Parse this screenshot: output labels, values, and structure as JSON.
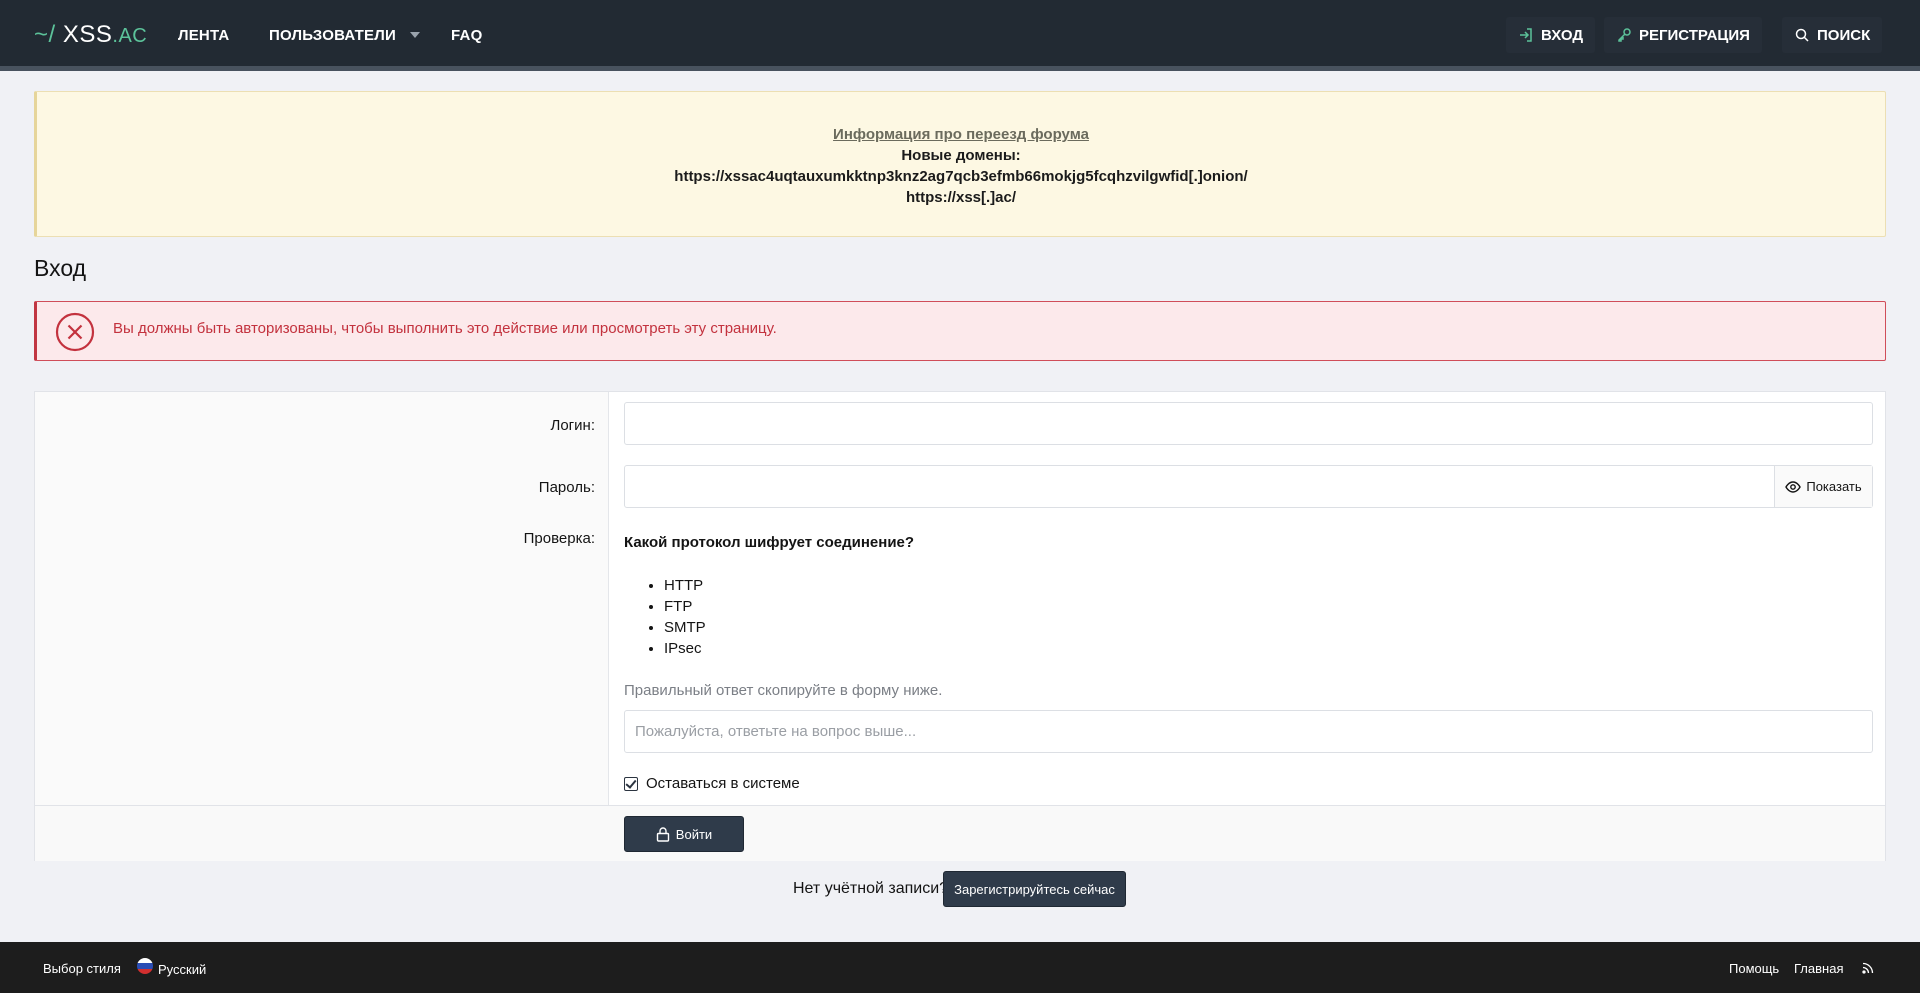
{
  "header": {
    "logo": {
      "tilde": "~/",
      "name": "XSS",
      "tld": ".AC"
    },
    "nav": [
      {
        "label": "ЛЕНТА"
      },
      {
        "label": "ПОЛЬЗОВАТЕЛИ"
      },
      {
        "label": "FAQ"
      }
    ],
    "actions": {
      "login": "ВХОД",
      "register": "РЕГИСТРАЦИЯ",
      "search": "ПОИСК"
    }
  },
  "notice": {
    "link": "Информация про переезд форума",
    "line1": "Новые домены:",
    "line2": "https://xssac4uqtauxumkktnp3knz2ag7qcb3efmb66mokjg5fcqhzvilgwfid[.]onion/",
    "line3": "https://xss[.]ac/"
  },
  "page_title": "Вход",
  "error_message": "Вы должны быть авторизованы, чтобы выполнить это действие или просмотреть эту страницу.",
  "form": {
    "login_label": "Логин:",
    "password_label": "Пароль:",
    "show_label": "Показать",
    "captcha_label": "Проверка:",
    "question": "Какой протокол шифрует соединение?",
    "options": [
      "HTTP",
      "FTP",
      "SMTP",
      "IPsec"
    ],
    "hint": "Правильный ответ скопируйте в форму ниже.",
    "answer_placeholder": "Пожалуйста, ответьте на вопрос выше...",
    "remember_label": "Оставаться в системе",
    "submit_label": "Войти"
  },
  "signup": {
    "prompt": "Нет учётной записи?",
    "button": "Зарегистрируйтесь сейчас"
  },
  "footer": {
    "style_chooser": "Выбор стиля",
    "language": "Русский",
    "help": "Помощь",
    "home": "Главная"
  },
  "colors": {
    "header_bg": "#222a33",
    "accent": "#5cc29a",
    "error": "#c3323e",
    "notice_bg": "#fdf8e3",
    "button_bg": "#2f3b4a"
  },
  "icons": [
    "sign-in-icon",
    "key-icon",
    "search-icon",
    "error-x-icon",
    "eye-icon",
    "lock-icon",
    "rss-icon",
    "russia-flag-icon"
  ]
}
